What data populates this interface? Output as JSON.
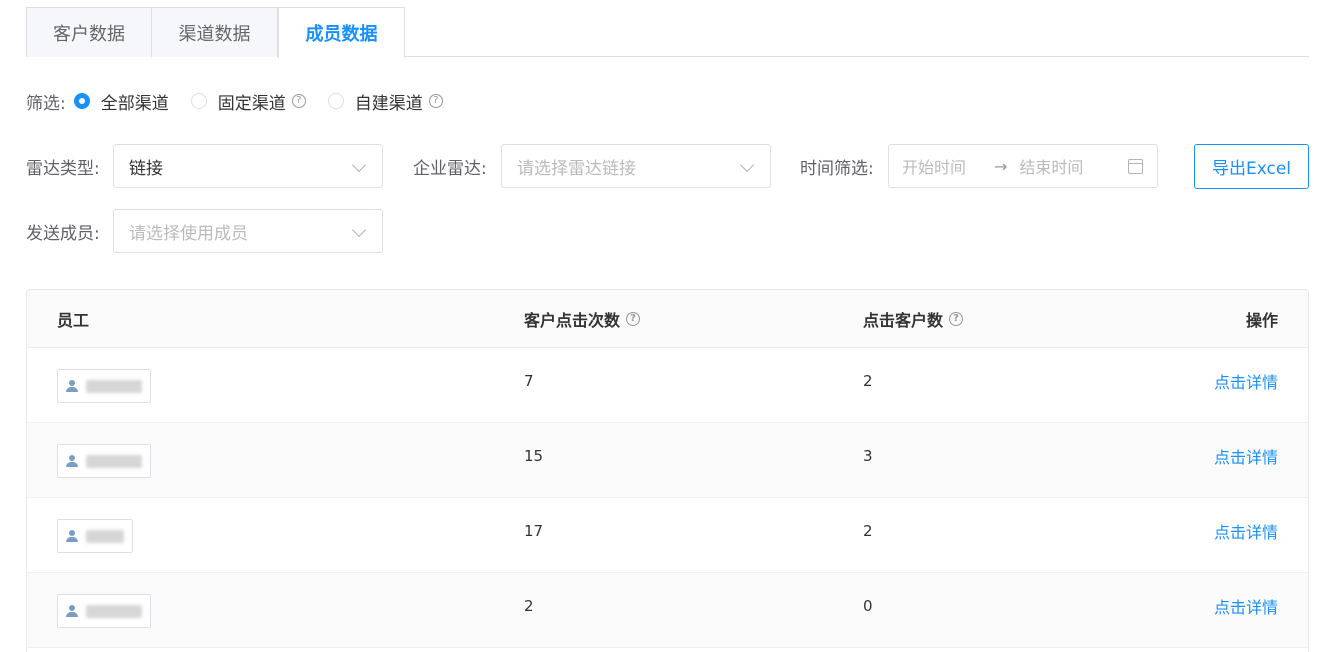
{
  "tabs": [
    {
      "label": "客户数据",
      "active": false
    },
    {
      "label": "渠道数据",
      "active": false
    },
    {
      "label": "成员数据",
      "active": true
    }
  ],
  "filter": {
    "label": "筛选:",
    "options": [
      {
        "label": "全部渠道",
        "checked": true,
        "help": false
      },
      {
        "label": "固定渠道",
        "checked": false,
        "help": true
      },
      {
        "label": "自建渠道",
        "checked": false,
        "help": true
      }
    ]
  },
  "form": {
    "radar_type": {
      "label": "雷达类型:",
      "value": "链接"
    },
    "enterprise_radar": {
      "label": "企业雷达:",
      "placeholder": "请选择雷达链接"
    },
    "time_filter": {
      "label": "时间筛选:",
      "start_placeholder": "开始时间",
      "arrow": "→",
      "end_placeholder": "结束时间"
    },
    "sender": {
      "label": "发送成员:",
      "placeholder": "请选择使用成员"
    },
    "export_label": "导出Excel"
  },
  "table": {
    "headers": {
      "employee": "员工",
      "client_clicks": "客户点击次数",
      "click_customers": "点击客户数",
      "operation": "操作"
    },
    "rows": [
      {
        "employee": "",
        "client_clicks": "7",
        "click_customers": "2",
        "action": "点击详情"
      },
      {
        "employee": "",
        "client_clicks": "15",
        "click_customers": "3",
        "action": "点击详情"
      },
      {
        "employee": "",
        "client_clicks": "17",
        "click_customers": "2",
        "action": "点击详情"
      },
      {
        "employee": "",
        "client_clicks": "2",
        "click_customers": "0",
        "action": "点击详情"
      }
    ]
  },
  "colors": {
    "accent": "#1890ff",
    "border": "#dcdfe6",
    "header_bg": "#fafafa"
  }
}
